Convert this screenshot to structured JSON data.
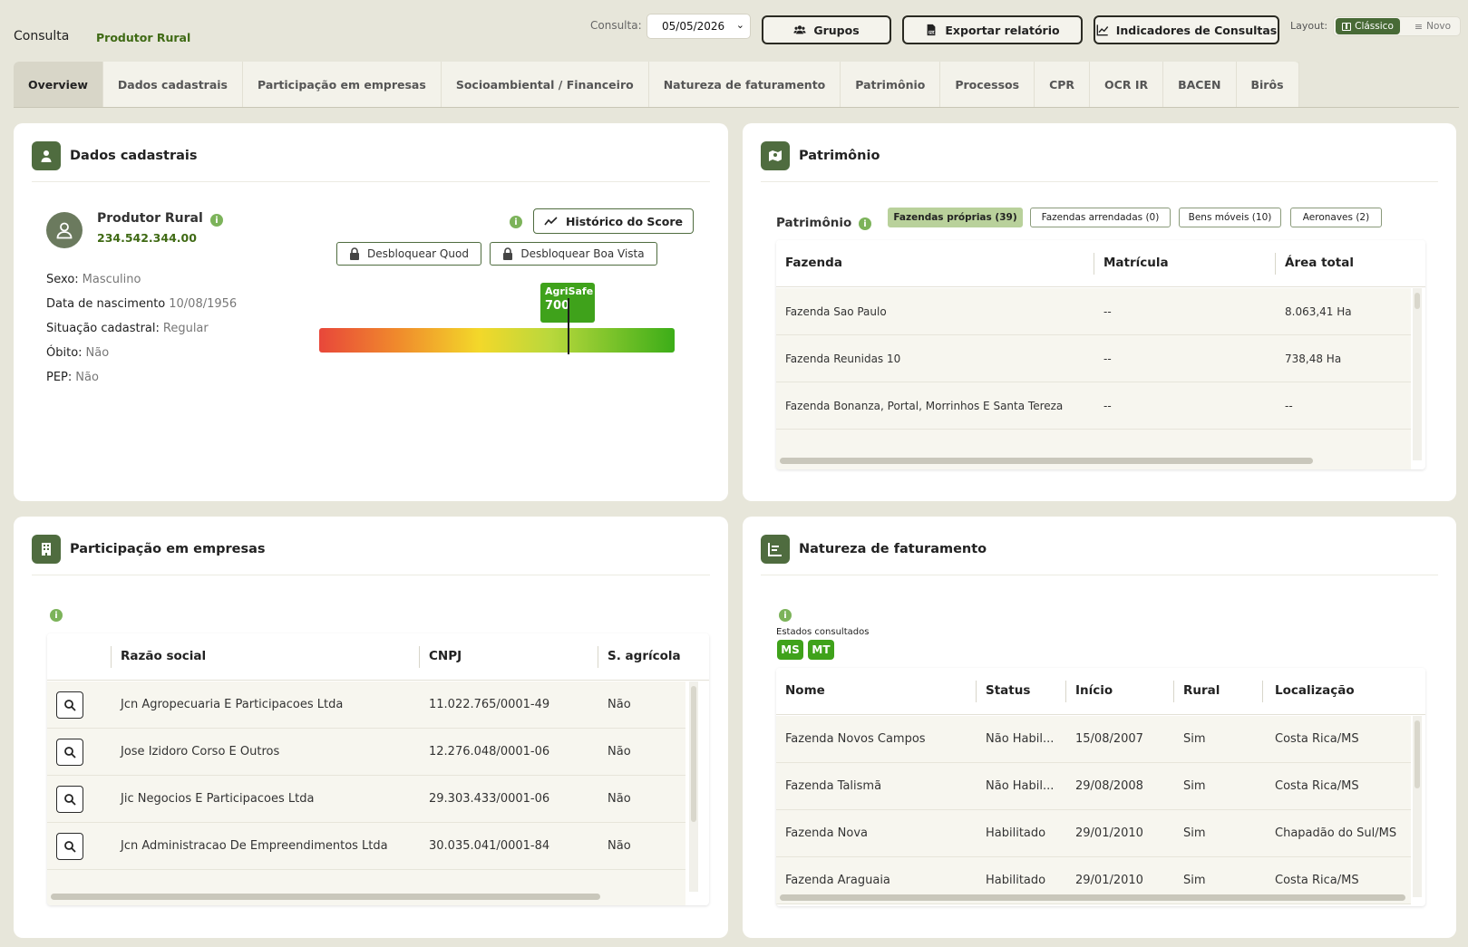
{
  "header": {
    "crumb": "Consulta",
    "entity": "Produtor Rural",
    "consulta_label": "Consulta:",
    "date_value": "05/05/2026",
    "buttons": {
      "grupos": "Grupos",
      "exportar": "Exportar relatório",
      "indicadores": "Indicadores de Consultas"
    },
    "layout_label": "Layout:",
    "layout_options": {
      "classico": "Clássico",
      "novo": "Novo"
    }
  },
  "tabs": [
    "Overview",
    "Dados cadastrais",
    "Participação em empresas",
    "Socioambiental / Financeiro",
    "Natureza de faturamento",
    "Patrimônio",
    "Processos",
    "CPR",
    "OCR IR",
    "BACEN",
    "Birôs"
  ],
  "dados": {
    "title": "Dados cadastrais",
    "name": "Produtor Rural",
    "value": "234.542.344.00",
    "fields": [
      {
        "label": "Sexo:",
        "value": "Masculino"
      },
      {
        "label": "Data de nascimento",
        "value": "10/08/1956"
      },
      {
        "label": "Situação cadastral:",
        "value": "Regular"
      },
      {
        "label": "Óbito:",
        "value": "Não"
      },
      {
        "label": "PEP:",
        "value": "Não"
      }
    ],
    "historico_label": "Histórico do Score",
    "unlock_quod": "Desbloquear Quod",
    "unlock_boavista": "Desbloquear Boa Vista",
    "score_name": "AgriSafe",
    "score_value": "700"
  },
  "patrimonio": {
    "title": "Patrimônio",
    "subtitle": "Patrimônio",
    "pills": [
      "Fazendas próprias (39)",
      "Fazendas arrendadas (0)",
      "Bens móveis (10)",
      "Aeronaves (2)"
    ],
    "columns": [
      "Fazenda",
      "Matrícula",
      "Área total"
    ],
    "rows": [
      [
        "Fazenda Sao Paulo",
        "--",
        "8.063,41 Ha"
      ],
      [
        "Fazenda Reunidas 10",
        "--",
        "738,48 Ha"
      ],
      [
        "Fazenda Bonanza, Portal, Morrinhos E Santa Tereza",
        "--",
        "--"
      ]
    ]
  },
  "participacao": {
    "title": "Participação em empresas",
    "columns": [
      "Razão social",
      "CNPJ",
      "S. agrícola"
    ],
    "rows": [
      [
        "Jcn Agropecuaria E Participacoes Ltda",
        "11.022.765/0001-49",
        "Não"
      ],
      [
        "Jose Izidoro Corso E Outros",
        "12.276.048/0001-06",
        "Não"
      ],
      [
        "Jic Negocios E Participacoes Ltda",
        "29.303.433/0001-06",
        "Não"
      ],
      [
        "Jcn Administracao De Empreendimentos Ltda",
        "30.035.041/0001-84",
        "Não"
      ]
    ]
  },
  "natureza": {
    "title": "Natureza de faturamento",
    "estados_label": "Estados consultados",
    "estados": [
      "MS",
      "MT"
    ],
    "columns": [
      "Nome",
      "Status",
      "Início",
      "Rural",
      "Localização"
    ],
    "rows": [
      [
        "Fazenda Novos Campos",
        "Não Habil...",
        "15/08/2007",
        "Sim",
        "Costa Rica/MS"
      ],
      [
        "Fazenda Talismã",
        "Não Habil...",
        "29/08/2008",
        "Sim",
        "Costa Rica/MS"
      ],
      [
        "Fazenda Nova",
        "Habilitado",
        "29/01/2010",
        "Sim",
        "Chapadão do Sul/MS"
      ],
      [
        "Fazenda Araguaia",
        "Habilitado",
        "29/01/2010",
        "Sim",
        "Costa Rica/MS"
      ]
    ]
  },
  "colors": {
    "accent": "#4f6c3f",
    "brand_green": "#3fa21b",
    "background": "#e7e6da"
  },
  "icons": [
    "users-icon",
    "pdf-icon",
    "trend-chart-icon",
    "grid-icon",
    "list-icon",
    "user-icon",
    "map-icon",
    "building-icon",
    "bar-list-icon",
    "lock-icon",
    "search-icon",
    "info-icon",
    "chevron-down-icon"
  ]
}
